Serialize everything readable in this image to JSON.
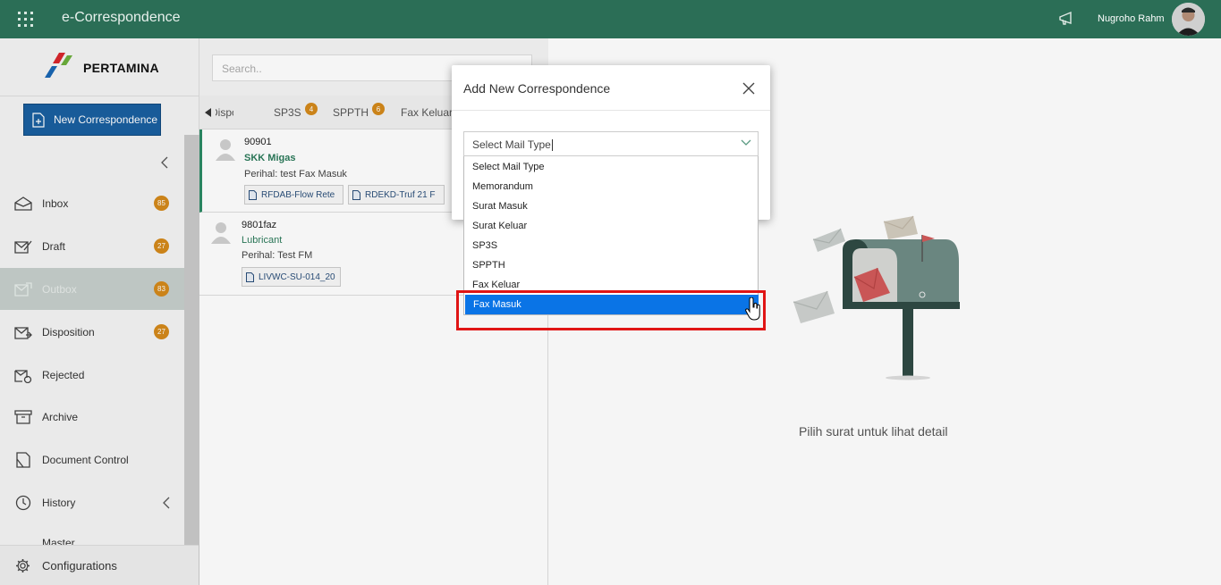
{
  "app": {
    "title": "e-Correspondence",
    "user_name": "Nugroho Rahm"
  },
  "sidebar": {
    "logo_text": "PERTAMINA",
    "new_button_label": "New Correspondence",
    "items": [
      {
        "label": "Inbox",
        "badge": "85"
      },
      {
        "label": "Draft",
        "badge": "27"
      },
      {
        "label": "Outbox",
        "badge": "83"
      },
      {
        "label": "Disposition",
        "badge": "27"
      },
      {
        "label": "Rejected"
      },
      {
        "label": "Archive"
      },
      {
        "label": "Document Control"
      },
      {
        "label": "History"
      },
      {
        "label": "Master"
      }
    ],
    "config_label": "Configurations"
  },
  "list": {
    "search_placeholder": "Search..",
    "tabs": [
      {
        "label": "Disposisi"
      },
      {
        "label": "SP3S",
        "badge": "4"
      },
      {
        "label": "SPPTH",
        "badge": "6"
      },
      {
        "label": "Fax Keluar"
      }
    ],
    "items": [
      {
        "number": "90901",
        "from": "SKK Migas",
        "subject": "Perihal: test Fax Masuk",
        "attachments": [
          "RFDAB-Flow Rete",
          "RDEKD-Truf 21 F"
        ]
      },
      {
        "number": "9801faz",
        "from": "Lubricant",
        "subject": "Perihal: Test FM",
        "attachments": [
          "LIVWC-SU-014_20"
        ]
      }
    ]
  },
  "detail": {
    "empty_text": "Pilih surat untuk lihat detail"
  },
  "modal": {
    "title": "Add New Correspondence",
    "select_value": "Select Mail Type",
    "options": [
      "Select Mail Type",
      "Memorandum",
      "Surat Masuk",
      "Surat Keluar",
      "SP3S",
      "SPPTH",
      "Fax Keluar",
      "Fax Masuk"
    ],
    "highlighted_option": "Fax Masuk"
  },
  "colors": {
    "topbar": "#2b6e56",
    "primary_button": "#1a5fa0",
    "badge": "#d4891b",
    "highlight": "#0a74e6",
    "annotation": "#e01515"
  }
}
